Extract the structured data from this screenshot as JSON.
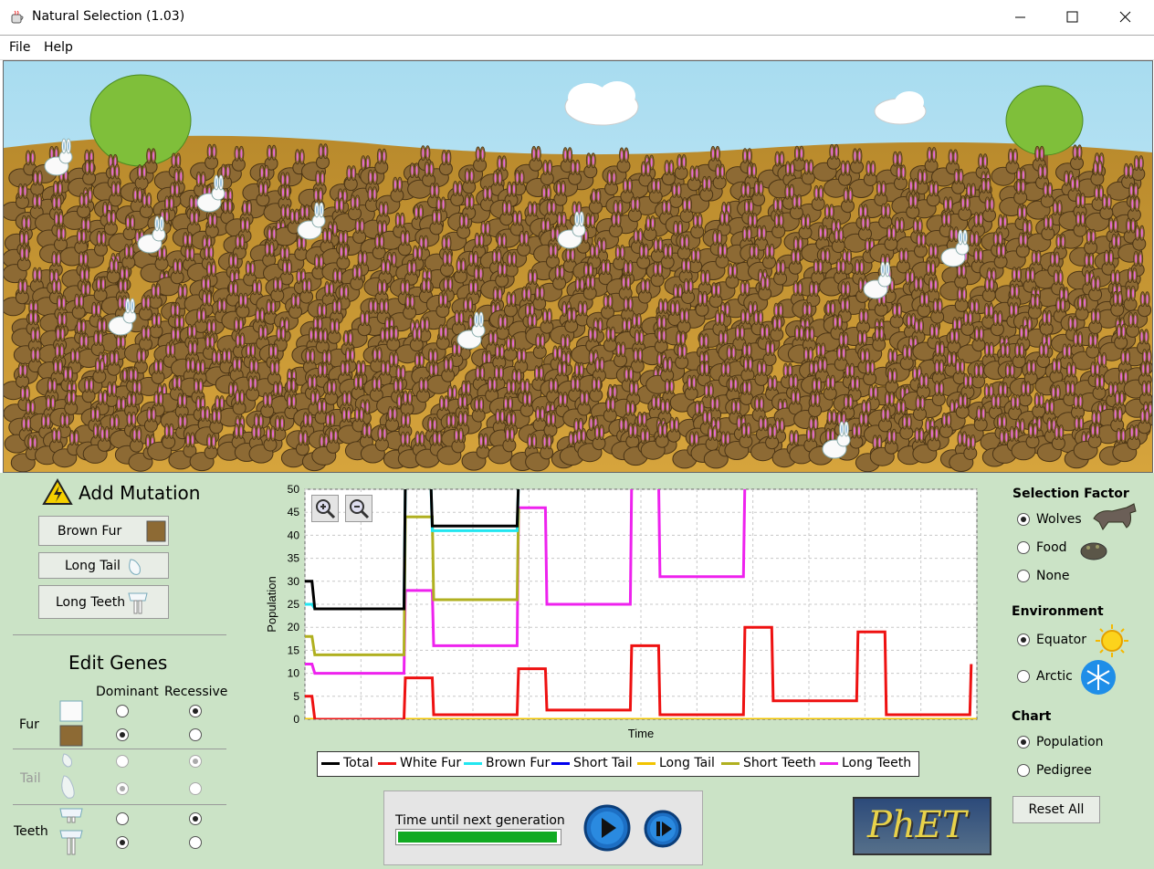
{
  "window": {
    "title": "Natural Selection (1.03)",
    "controls": [
      "minimize-icon",
      "maximize-icon",
      "close-icon"
    ]
  },
  "menu": {
    "file": "File",
    "help": "Help"
  },
  "mutation": {
    "title": "Add Mutation",
    "buttons": [
      "Brown Fur",
      "Long Tail",
      "Long Teeth"
    ]
  },
  "genes": {
    "title": "Edit Genes",
    "dominant": "Dominant",
    "recessive": "Recessive",
    "fur": "Fur",
    "tail": "Tail",
    "teeth": "Teeth"
  },
  "selection_factor": {
    "title": "Selection Factor",
    "options": [
      "Wolves",
      "Food",
      "None"
    ],
    "selected": "Wolves"
  },
  "environment": {
    "title": "Environment",
    "options": [
      "Equator",
      "Arctic"
    ],
    "selected": "Equator"
  },
  "chart_mode": {
    "title": "Chart",
    "options": [
      "Population",
      "Pedigree"
    ],
    "selected": "Population"
  },
  "reset_label": "Reset All",
  "timer": {
    "label": "Time until next generation",
    "progress": 1.0
  },
  "logo_text": "PhET",
  "colors": {
    "panel": "#cbe3c6",
    "sky": "#a8d8ee",
    "ground": "#c89a3a",
    "bunny_brown": "#8d6a34",
    "total": "#000000",
    "white_fur": "#ee1111",
    "brown_fur": "#22e6f0",
    "short_tail": "#0000ee",
    "long_tail": "#f2c400",
    "short_teeth": "#b0b020",
    "long_teeth": "#ee22ee"
  },
  "chart_data": {
    "type": "line",
    "title": "",
    "xlabel": "Time",
    "ylabel": "Population",
    "ylim": [
      0,
      50
    ],
    "yticks": [
      0,
      5,
      10,
      15,
      20,
      25,
      30,
      35,
      40,
      45,
      50
    ],
    "series": [
      {
        "name": "Total",
        "color": "#000000",
        "points": [
          [
            0,
            30
          ],
          [
            1,
            30
          ],
          [
            1.4,
            24
          ],
          [
            14,
            24
          ],
          [
            14.2,
            52
          ],
          [
            17,
            52
          ],
          [
            17.8,
            52
          ],
          [
            18,
            42
          ],
          [
            30,
            42
          ],
          [
            30.2,
            52
          ]
        ]
      },
      {
        "name": "White Fur",
        "color": "#ee1111",
        "points": [
          [
            0,
            5
          ],
          [
            1,
            5
          ],
          [
            1.4,
            0
          ],
          [
            14,
            0
          ],
          [
            14.2,
            9
          ],
          [
            18,
            9
          ],
          [
            18.2,
            1
          ],
          [
            30,
            1
          ],
          [
            30.2,
            11
          ],
          [
            34,
            11
          ],
          [
            34.2,
            2
          ],
          [
            46,
            2
          ],
          [
            46.2,
            16
          ],
          [
            50,
            16
          ],
          [
            50.2,
            1
          ],
          [
            62,
            1
          ],
          [
            62.2,
            20
          ],
          [
            66,
            20
          ],
          [
            66.2,
            4
          ],
          [
            78,
            4
          ],
          [
            78.2,
            19
          ],
          [
            82,
            19
          ],
          [
            82.2,
            1
          ],
          [
            94,
            1
          ],
          [
            94.2,
            12
          ]
        ]
      },
      {
        "name": "Brown Fur",
        "color": "#22e6f0",
        "points": [
          [
            0,
            25
          ],
          [
            1,
            25
          ],
          [
            1.4,
            24
          ],
          [
            14,
            24
          ],
          [
            14.2,
            52
          ],
          [
            17.8,
            52
          ],
          [
            18,
            41
          ],
          [
            30,
            41
          ],
          [
            30.2,
            52
          ]
        ]
      },
      {
        "name": "Short Tail",
        "color": "#0000ee",
        "points": []
      },
      {
        "name": "Long Tail",
        "color": "#f2c400",
        "points": [
          [
            0,
            0
          ],
          [
            95,
            0
          ]
        ]
      },
      {
        "name": "Short Teeth",
        "color": "#b0b020",
        "points": [
          [
            0,
            18
          ],
          [
            1,
            18
          ],
          [
            1.4,
            14
          ],
          [
            14,
            14
          ],
          [
            14.2,
            44
          ],
          [
            18,
            44
          ],
          [
            18.2,
            26
          ],
          [
            30,
            26
          ],
          [
            30.2,
            46
          ]
        ]
      },
      {
        "name": "Long Teeth",
        "color": "#ee22ee",
        "points": [
          [
            0,
            12
          ],
          [
            1,
            12
          ],
          [
            1.4,
            10
          ],
          [
            14,
            10
          ],
          [
            14.2,
            28
          ],
          [
            18,
            28
          ],
          [
            18.2,
            16
          ],
          [
            30,
            16
          ],
          [
            30.2,
            46
          ],
          [
            34,
            46
          ],
          [
            34.2,
            25
          ],
          [
            46,
            25
          ],
          [
            46.2,
            52
          ],
          [
            50,
            52
          ],
          [
            50.2,
            31
          ],
          [
            62,
            31
          ],
          [
            62.2,
            52
          ]
        ]
      }
    ],
    "xlim": [
      0,
      95
    ],
    "grid": true
  }
}
